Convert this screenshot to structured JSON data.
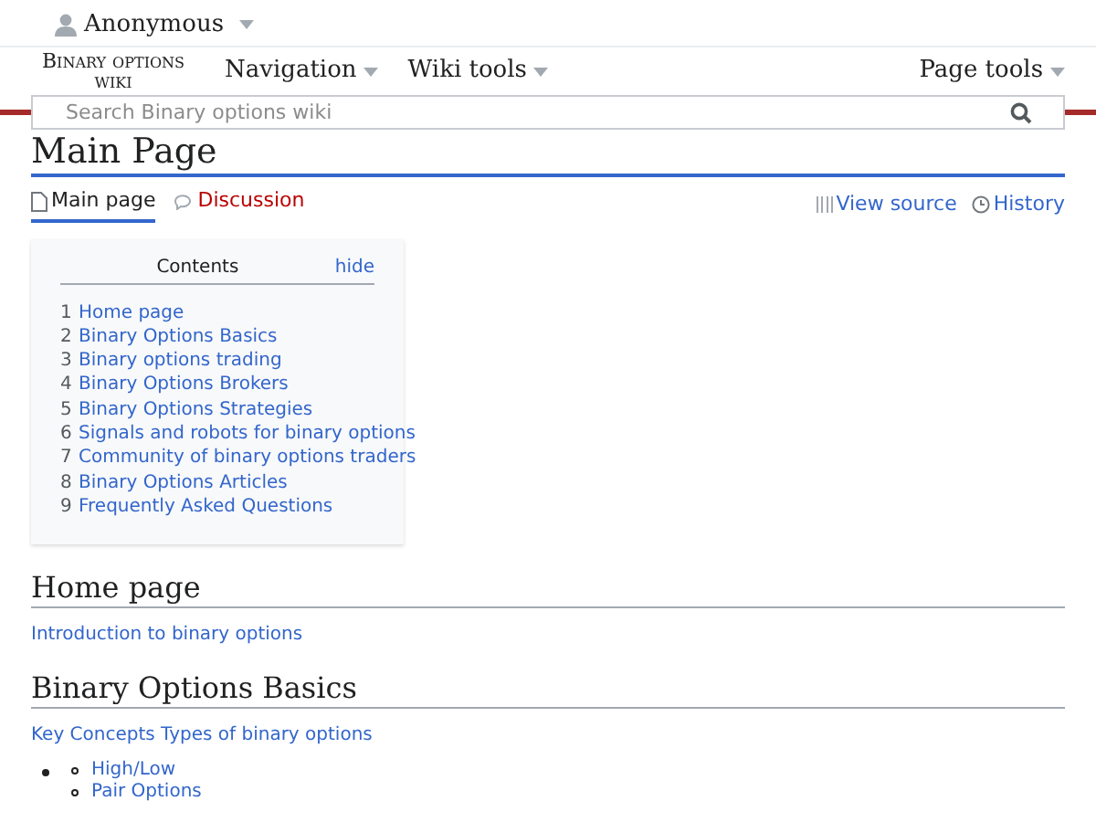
{
  "user_menu": {
    "label": "Anonymous"
  },
  "header": {
    "logo": "Binary options wiki",
    "menus": [
      "Navigation",
      "Wiki tools"
    ],
    "right_menu": "Page tools"
  },
  "search": {
    "placeholder": "Search Binary options wiki"
  },
  "page": {
    "title": "Main Page"
  },
  "page_tabs": [
    {
      "label": "Main page",
      "selected": true,
      "missing": false
    },
    {
      "label": "Discussion",
      "selected": false,
      "missing": true
    }
  ],
  "page_actions": [
    "View source",
    "History"
  ],
  "toc": {
    "title": "Contents",
    "toggle": "hide",
    "items": [
      {
        "number": "1",
        "label": "Home page"
      },
      {
        "number": "2",
        "label": "Binary Options Basics"
      },
      {
        "number": "3",
        "label": "Binary options trading"
      },
      {
        "number": "4",
        "label": "Binary Options Brokers"
      },
      {
        "number": "5",
        "label": "Binary Options Strategies"
      },
      {
        "number": "6",
        "label": "Signals and robots for binary options"
      },
      {
        "number": "7",
        "label": "Community of binary options traders"
      },
      {
        "number": "8",
        "label": "Binary Options Articles"
      },
      {
        "number": "9",
        "label": "Frequently Asked Questions"
      }
    ]
  },
  "sections": [
    {
      "heading": "Home page",
      "links": [
        "Introduction to binary options"
      ]
    },
    {
      "heading": "Binary Options Basics",
      "links": [
        "Key Concepts Types of binary options"
      ],
      "list": [
        "High/Low",
        "Pair Options"
      ]
    }
  ]
}
